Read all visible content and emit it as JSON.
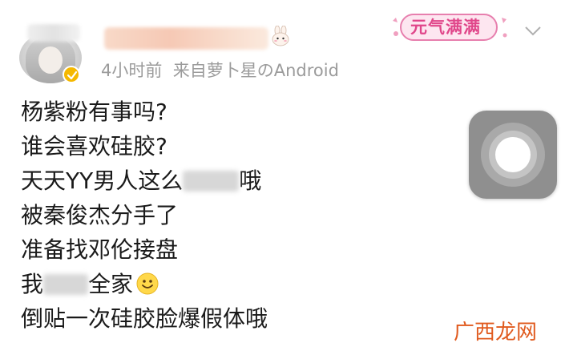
{
  "post": {
    "timestamp": "4小时前",
    "source": "来自萝卜星のAndroid",
    "sticker_text": "元气满满",
    "lines": [
      {
        "text": "杨紫粉有事吗?"
      },
      {
        "text": "谁会喜欢硅胶?"
      },
      {
        "text_before": "天天YY男人这么",
        "text_after": "哦"
      },
      {
        "text": "被秦俊杰分手了"
      },
      {
        "text": "准备找邓伦接盘"
      },
      {
        "text_before": "我",
        "text_after": "全家"
      },
      {
        "text": "倒贴一次硅胶脸爆假体哦"
      }
    ]
  },
  "watermark": "广西龙网",
  "colors": {
    "meta_gray": "#9b9b9b",
    "sticker_pink": "#e0468a",
    "watermark_orange": "#e05a1e",
    "badge_gold": "#f5b800"
  },
  "icons": {
    "avatar": "avatar",
    "vip_badge": "vip-badge-icon",
    "bunny": "bunny-icon",
    "chevron": "chevron-down-icon",
    "emoji": "smile-emoji-icon",
    "float_button": "floating-action-button"
  }
}
